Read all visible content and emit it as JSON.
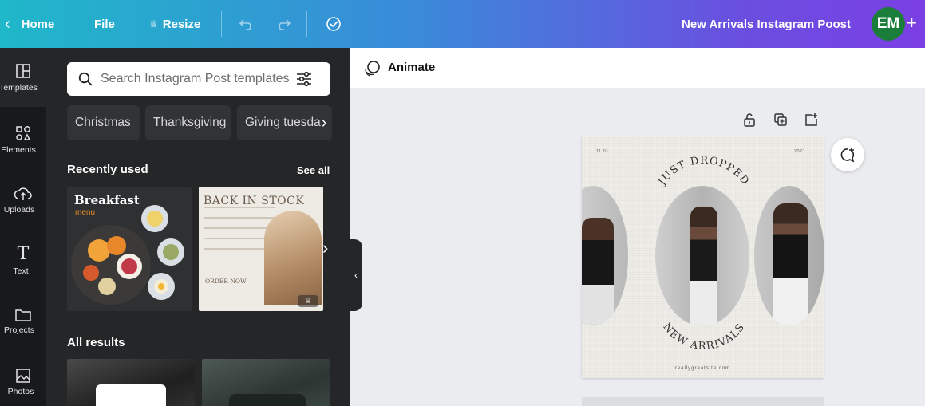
{
  "topbar": {
    "home_label": "Home",
    "file_label": "File",
    "resize_label": "Resize",
    "design_title": "New Arrivals Instagram Poost",
    "avatar_initials": "EM"
  },
  "rail": {
    "items": [
      {
        "label": "Templates",
        "icon": "templates-icon"
      },
      {
        "label": "Elements",
        "icon": "elements-icon"
      },
      {
        "label": "Uploads",
        "icon": "uploads-icon"
      },
      {
        "label": "Text",
        "icon": "text-icon"
      },
      {
        "label": "Projects",
        "icon": "projects-icon"
      },
      {
        "label": "Photos",
        "icon": "photos-icon"
      }
    ]
  },
  "panel": {
    "search_placeholder": "Search Instagram Post templates",
    "chips": [
      "Christmas",
      "Thanksgiving",
      "Giving tuesda"
    ],
    "recently_used_label": "Recently used",
    "see_all_label": "See all",
    "all_results_label": "All results",
    "recent": [
      {
        "title": "Breakfast",
        "subtitle": "menu"
      },
      {
        "title": "BACK IN STOCK",
        "footer": "ORDER NOW"
      }
    ]
  },
  "editor": {
    "animate_label": "Animate",
    "design": {
      "date_left": "11.01",
      "date_right": "2021",
      "arc_top": "JUST DROPPED",
      "arc_bottom": "NEW ARRIVALS",
      "url": "reallygreatsite.com"
    }
  },
  "colors": {
    "rail_bg": "#18191b",
    "panel_bg": "#252627",
    "canvas_bg": "#ebecf0",
    "avatar_bg": "#1b7d3a"
  }
}
